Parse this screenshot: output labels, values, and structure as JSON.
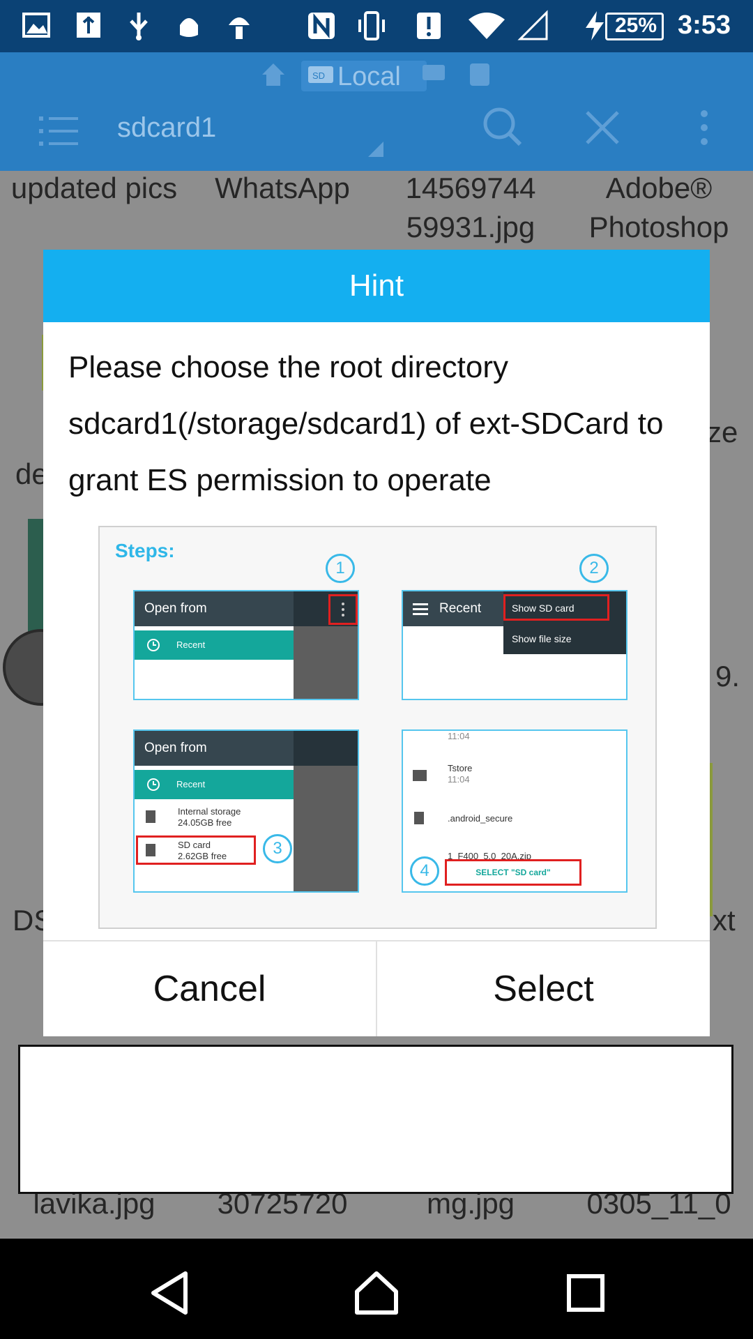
{
  "status_bar": {
    "battery": "25%",
    "time": "3:53",
    "icons": [
      "photo-notification-icon",
      "usb-icon",
      "usb-debug-icon",
      "android-icon",
      "android-icon",
      "nfc-icon",
      "vibrate-icon",
      "alert-icon",
      "wifi-icon",
      "signal-icon",
      "charging-icon"
    ]
  },
  "header": {
    "breadcrumb_label": "Local",
    "path": "sdcard1",
    "icons": [
      "home-icon",
      "sd-card-icon",
      "menu-list-icon",
      "search-icon",
      "close-icon",
      "more-vert-icon"
    ]
  },
  "background_grid": {
    "row1": [
      "updated pics",
      "WhatsApp",
      "14569744 59931.jpg",
      "Adobe® Photoshop"
    ],
    "partial": [
      "de",
      "ze",
      "9.",
      "DS",
      "xt"
    ],
    "bottom_row": [
      "lavika.jpg",
      "30725720",
      "mg.jpg",
      "0305_11_0"
    ]
  },
  "dialog": {
    "title": "Hint",
    "message": "Please choose the root directory sdcard1(/storage/sdcard1) of ext-SDCard to grant ES permission to operate",
    "steps": {
      "title": "Steps:",
      "step1": {
        "number": "1",
        "bar": "Open from",
        "item": "Recent"
      },
      "step2": {
        "number": "2",
        "bar": "Recent",
        "menu1": "Show SD card",
        "menu2": "Show file size"
      },
      "step3": {
        "number": "3",
        "bar": "Open from",
        "item": "Recent",
        "storage1": "Internal storage",
        "storage1_free": "24.05GB free",
        "storage2": "SD card",
        "storage2_free": "2.62GB free"
      },
      "step4": {
        "number": "4",
        "time1": "11:04",
        "folder": "Tstore",
        "time2": "11:04",
        "file1": ".android_secure",
        "file2": "1_F400_5.0_20A.zip",
        "button": "SELECT \"SD card\""
      }
    },
    "cancel_label": "Cancel",
    "select_label": "Select"
  },
  "nav": {
    "icons": [
      "back-icon",
      "home-nav-icon",
      "recents-icon"
    ]
  }
}
